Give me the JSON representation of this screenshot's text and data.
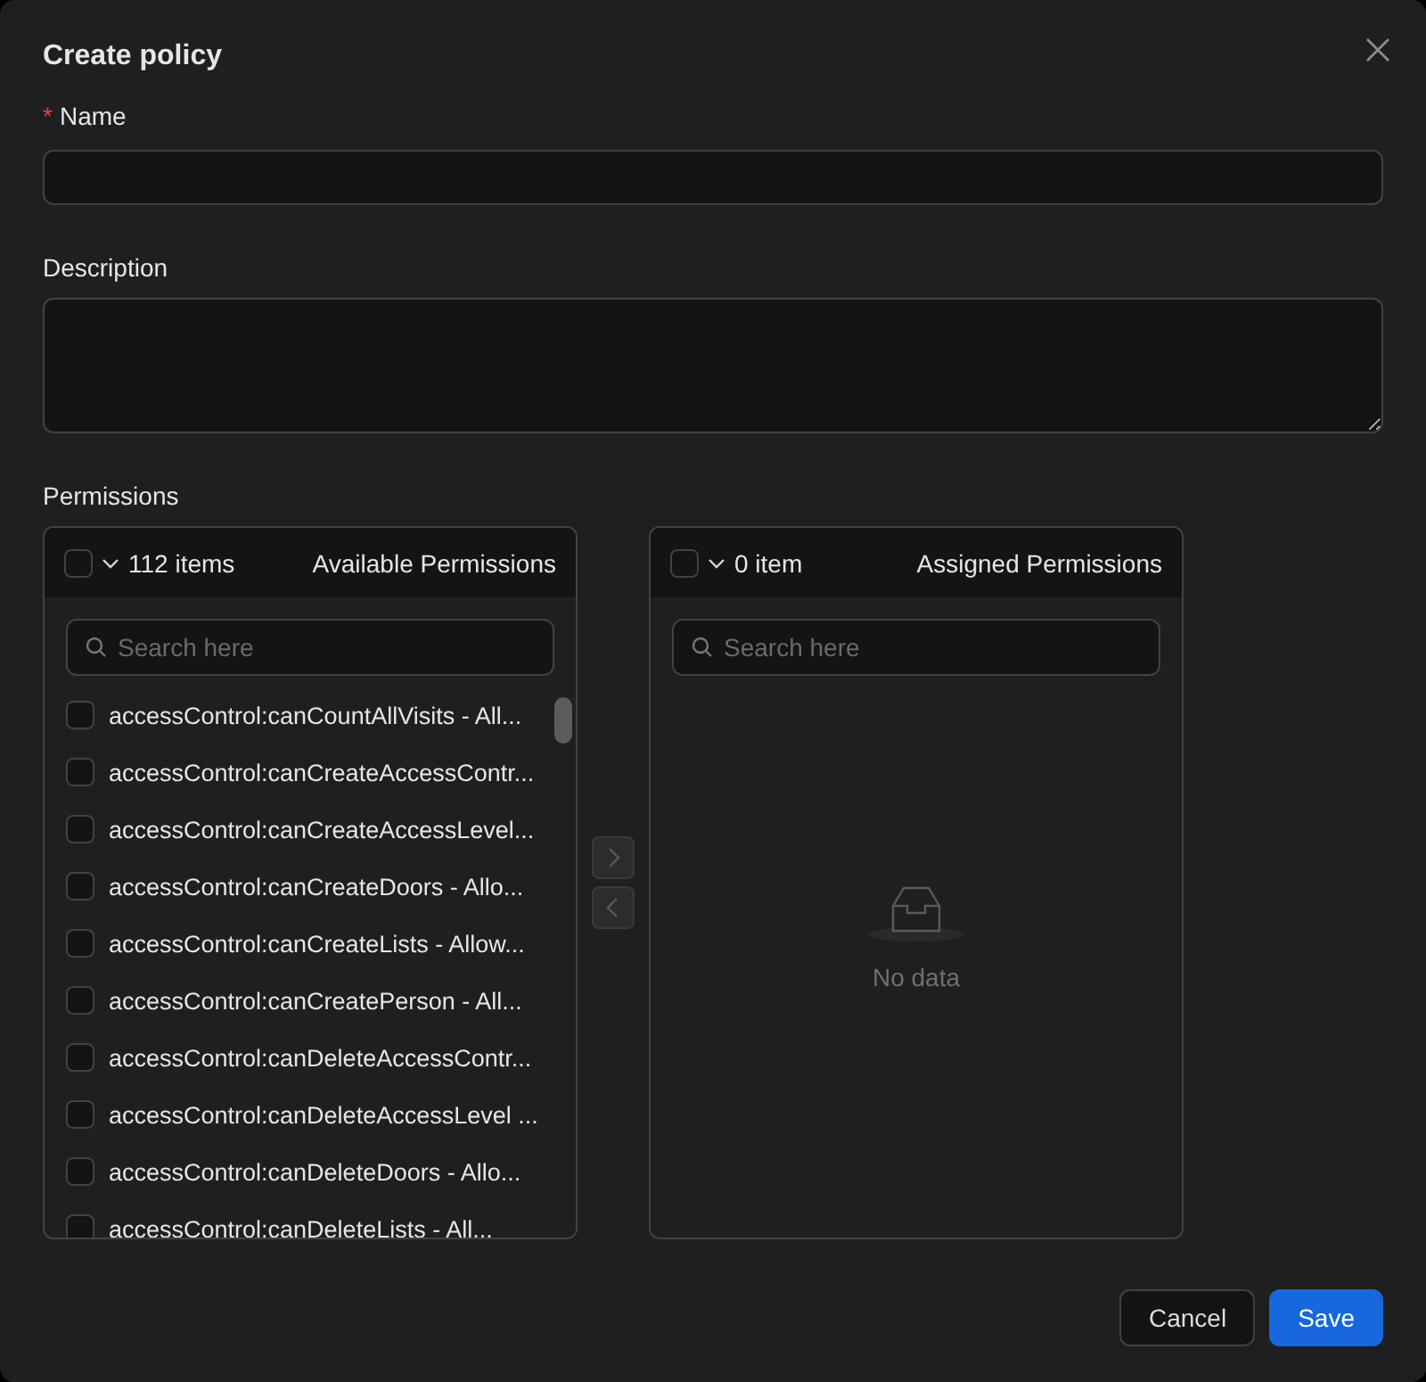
{
  "dialog": {
    "title": "Create policy"
  },
  "fields": [
    {
      "label": "Name",
      "required_mark": "*",
      "kind": "input"
    },
    {
      "label": "Description",
      "kind": "textarea"
    }
  ],
  "permissions": {
    "label": "Permissions",
    "source": {
      "checked": false,
      "count": "112 items",
      "title": "Available Permissions",
      "search_placeholder": "Search here",
      "items": [
        {
          "label": "accessControl:canCountAllVisits - All...",
          "checked": false
        },
        {
          "label": "accessControl:canCreateAccessContr...",
          "checked": false
        },
        {
          "label": "accessControl:canCreateAccessLevel...",
          "checked": false
        },
        {
          "label": "accessControl:canCreateDoors - Allo...",
          "checked": false
        },
        {
          "label": "accessControl:canCreateLists - Allow...",
          "checked": false
        },
        {
          "label": "accessControl:canCreatePerson - All...",
          "checked": false
        },
        {
          "label": "accessControl:canDeleteAccessContr...",
          "checked": false
        },
        {
          "label": "accessControl:canDeleteAccessLevel ...",
          "checked": false
        },
        {
          "label": "accessControl:canDeleteDoors - Allo...",
          "checked": false
        },
        {
          "label": "accessControl:canDeleteLists - All...",
          "checked": false
        }
      ]
    },
    "operations": [
      {
        "kind": "right",
        "disabled": true
      },
      {
        "kind": "left",
        "disabled": true
      }
    ],
    "target": {
      "checked": false,
      "count": "0 item",
      "title": "Assigned Permissions",
      "search_placeholder": "Search here",
      "empty_text": "No data"
    }
  },
  "buttons": [
    {
      "label": "Cancel",
      "kind": "default"
    },
    {
      "label": "Save",
      "kind": "primary"
    }
  ]
}
